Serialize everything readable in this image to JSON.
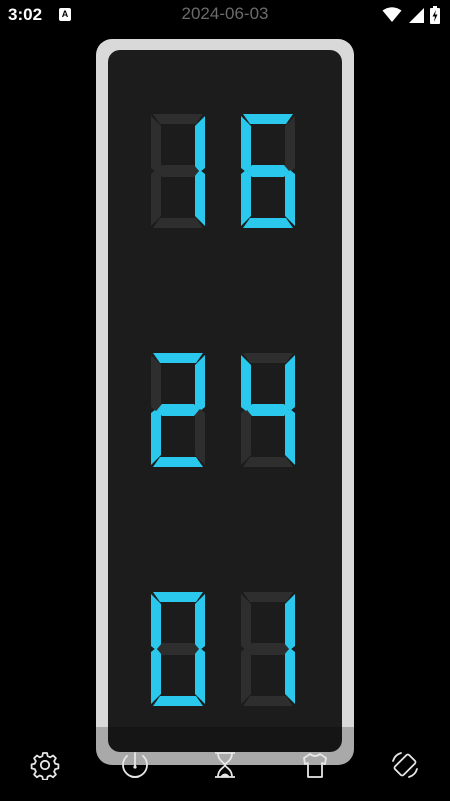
{
  "status_bar": {
    "time": "3:02",
    "notification_icon": "a-letter-icon",
    "date": "2024-06-03",
    "icons": [
      "wifi-icon",
      "signal-icon",
      "battery-charging-icon"
    ]
  },
  "clock": {
    "hours": [
      "1",
      "6"
    ],
    "minutes": [
      "2",
      "4"
    ],
    "seconds": [
      "0",
      "1"
    ],
    "time_text": "16:24:01",
    "colors": {
      "segment_on": "#29c8ec",
      "segment_off": "#2e2e2e",
      "face": "#1c1c1c",
      "frame": "#d9d9d9",
      "background": "#000000"
    }
  },
  "bottom_nav": {
    "items": [
      {
        "name": "settings-button",
        "icon": "gear-icon"
      },
      {
        "name": "dial-button",
        "icon": "dial-needle-icon"
      },
      {
        "name": "timer-button",
        "icon": "hourglass-icon"
      },
      {
        "name": "theme-button",
        "icon": "shirt-icon"
      },
      {
        "name": "rotate-button",
        "icon": "screen-rotation-icon"
      }
    ]
  }
}
